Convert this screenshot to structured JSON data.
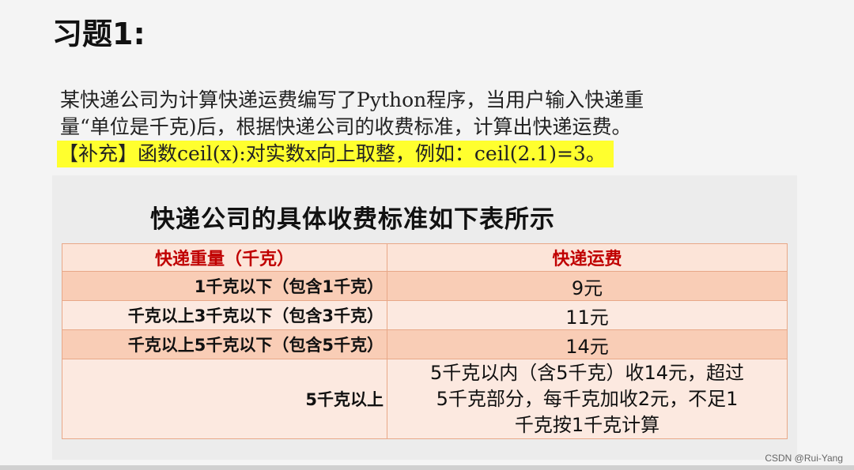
{
  "title": "习题1:",
  "paragraph": {
    "line1": "某快递公司为计算快递运费编写了Python程序，当用户输入快递重",
    "line2": "量“单位是千克)后，根据快递公司的收费标准，计算出快递运费。",
    "note": "【补充】函数ceil(x):对实数x向上取整，例如：ceil(2.1)=3。"
  },
  "table": {
    "caption": "快递公司的具体收费标准如下表所示",
    "headers": [
      "快递重量（千克）",
      "快递运费"
    ],
    "rows": [
      {
        "weight": "1千克以下（包含1千克）",
        "fee": "9元"
      },
      {
        "weight": "千克以上3千克以下（包含3千克）",
        "fee": "11元"
      },
      {
        "weight": "千克以上5千克以下（包含5千克）",
        "fee": "14元"
      },
      {
        "weight": "5千克以上",
        "fee_lines": [
          "5千克以内（含5千克）收14元，超过",
          "5千克部分，每千克加收2元，不足1",
          "千克按1千克计算"
        ]
      }
    ]
  },
  "watermark": "CSDN @Rui-Yang",
  "colors": {
    "header_text": "#c00000",
    "highlight": "#ffff2e",
    "row_dark": "#f9cdb6",
    "row_light": "#fce9e0",
    "border": "#e8a888"
  }
}
